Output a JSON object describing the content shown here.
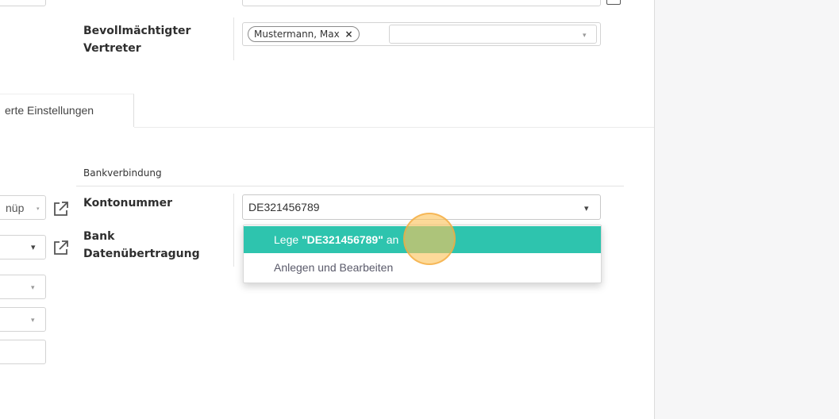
{
  "form": {
    "representative_label": "Bevollmächtigter Vertreter",
    "representative_tag": "Mustermann, Max",
    "tab_label": "erte Einstellungen",
    "section_title": "Bankverbindung",
    "account_label": "Kontonummer",
    "account_value": "DE321456789",
    "bank_transfer_label": "Bank Datenübertragung",
    "left_field_text": "nüp"
  },
  "dropdown": {
    "create_prefix": "Lege ",
    "create_value": "\"DE321456789\"",
    "create_suffix": " an",
    "create_edit_label": "Anlegen und Bearbeiten"
  },
  "colors": {
    "highlight": "#2ec4ae",
    "cursor": "#fcc45a"
  },
  "icons": {
    "external_link": "external-link-icon",
    "remove_tag": "close-icon",
    "caret": "chevron-down-icon"
  }
}
